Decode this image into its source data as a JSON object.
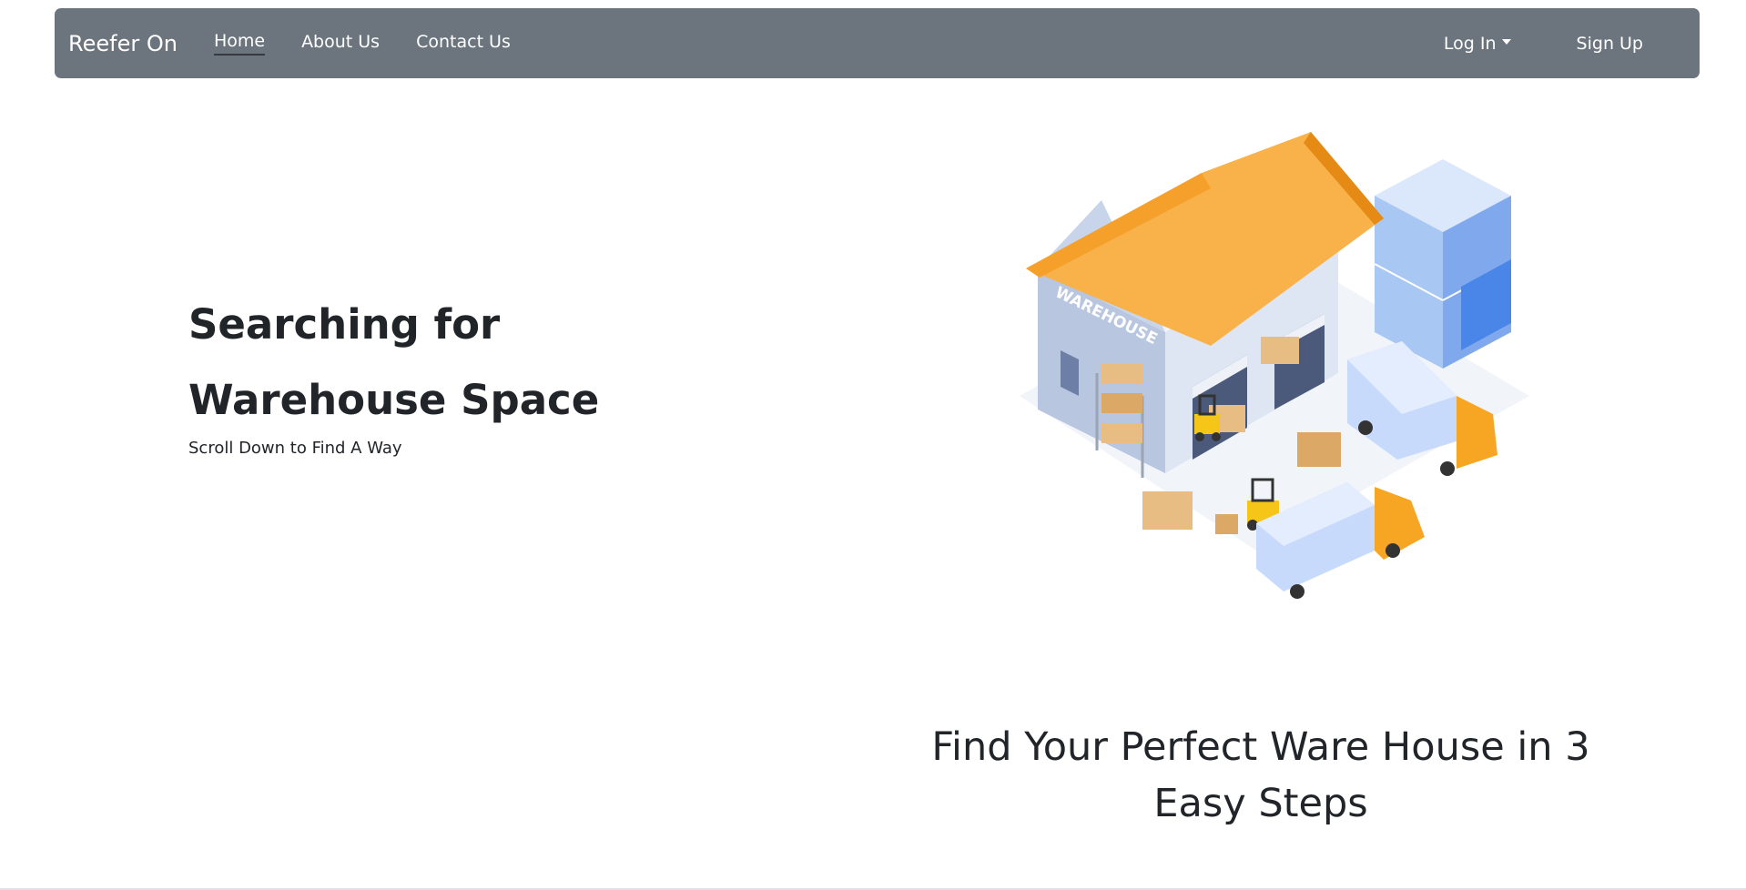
{
  "navbar": {
    "brand": "Reefer On",
    "links": [
      {
        "label": "Home",
        "active": true
      },
      {
        "label": "About Us",
        "active": false
      },
      {
        "label": "Contact Us",
        "active": false
      }
    ],
    "login_label": "Log In",
    "signup_label": "Sign Up",
    "background": "#6c757d"
  },
  "hero": {
    "title_line1": "Searching for",
    "title_line2": "Warehouse Space",
    "subtitle": "Scroll Down to Find A Way",
    "illustration_sign": "WAREHOUSE"
  },
  "steps": {
    "title": "Find Your Perfect Ware House in 3 Easy Steps"
  },
  "colors": {
    "roof": "#f9b24a",
    "building": "#c5d3ec",
    "truck_body": "#c8dafc",
    "truck_cab": "#f6a623",
    "boxes": "#e7bd83",
    "forklift": "#f5c518"
  }
}
